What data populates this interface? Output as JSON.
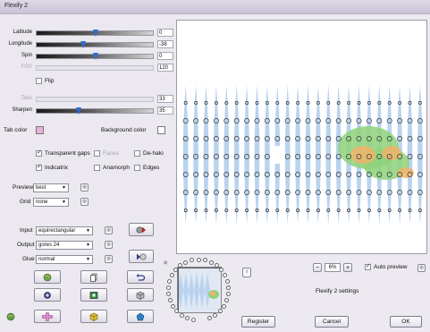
{
  "window": {
    "title": "Flexify 2"
  },
  "sliders": [
    {
      "label": "Latitude",
      "value": "0",
      "enabled": true,
      "pos": 0.5
    },
    {
      "label": "Longitude",
      "value": "-38",
      "enabled": true,
      "pos": 0.39
    },
    {
      "label": "Spin",
      "value": "0",
      "enabled": true,
      "pos": 0.5
    },
    {
      "label": "FOV",
      "value": "120",
      "enabled": false,
      "pos": 0
    },
    {
      "label": "Tabs",
      "value": "33",
      "enabled": false,
      "pos": 0
    },
    {
      "label": "Sharpen",
      "value": "35",
      "enabled": true,
      "pos": 0.35
    }
  ],
  "flip": {
    "label": "Flip",
    "checked": false
  },
  "tab_color": {
    "label": "Tab color",
    "color": "#e7b3d8"
  },
  "background_color": {
    "label": "Background color",
    "color": "#ffffff"
  },
  "options": {
    "transparent_gaps": {
      "label": "Transparent gaps",
      "checked": true
    },
    "faces": {
      "label": "Faces",
      "checked": false
    },
    "dehalo": {
      "label": "De-halo",
      "checked": false
    },
    "indicatrix": {
      "label": "Indicatrix",
      "checked": true
    },
    "anamorph": {
      "label": "Anamorph",
      "checked": false
    },
    "edges": {
      "label": "Edges",
      "checked": false
    }
  },
  "preview_select": {
    "label": "Preview",
    "value": "best"
  },
  "grid_select": {
    "label": "Grid",
    "value": "none"
  },
  "input_select": {
    "label": "Input",
    "value": "equirectangular"
  },
  "output_select": {
    "label": "Output",
    "value": "gores 24"
  },
  "glue_select": {
    "label": "Glue",
    "value": "normal"
  },
  "zoom": {
    "minus": "−",
    "value": "6%",
    "plus": "+"
  },
  "auto_preview": {
    "label": "Auto preview",
    "checked": true
  },
  "settings_label": "Flexify 2 settings",
  "buttons": {
    "register": "Register",
    "cancel": "Cancel",
    "ok": "OK"
  },
  "colors": {
    "gore_fill": "#b9d3ef",
    "land_green": "#8fd27a",
    "land_orange": "#f0b36a"
  }
}
